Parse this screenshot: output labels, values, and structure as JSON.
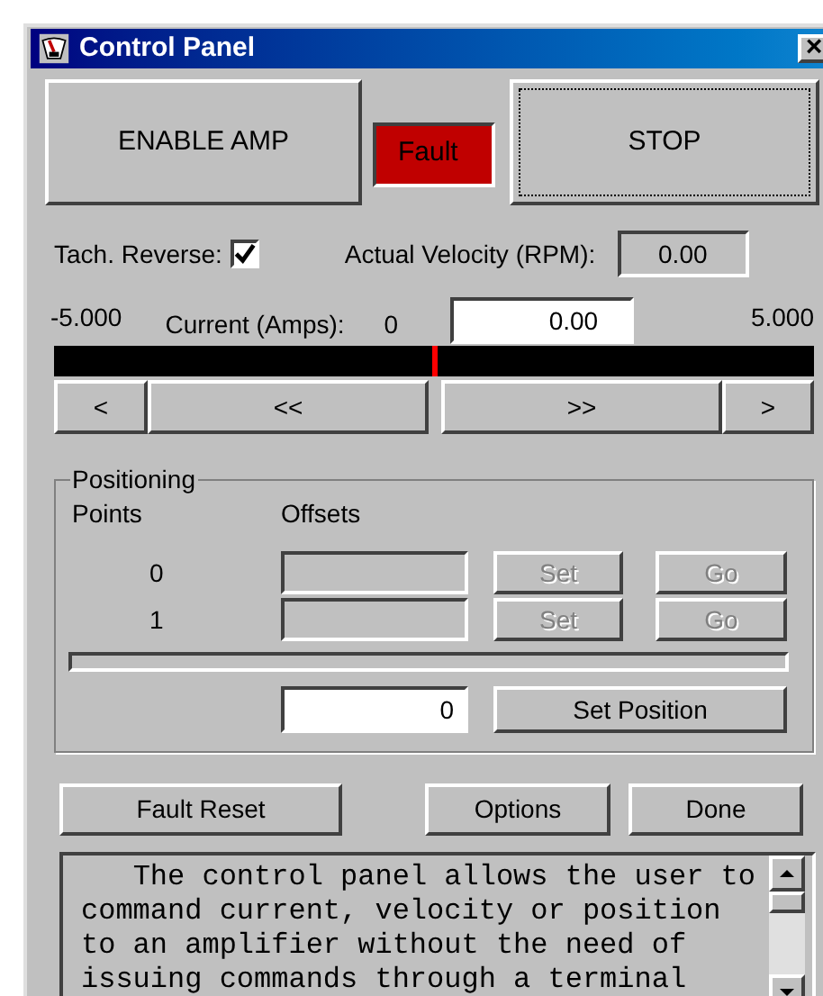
{
  "window": {
    "title": "Control Panel",
    "close": "×"
  },
  "enable_button": "ENABLE AMP",
  "fault_indicator": {
    "label": "Fault",
    "on": true
  },
  "stop_button": {
    "label": "STOP",
    "focused": true
  },
  "tach_reverse": {
    "label": "Tach. Reverse:",
    "checked": true
  },
  "actual_velocity": {
    "label": "Actual Velocity (RPM):",
    "value": "0.00"
  },
  "current": {
    "min": "-5.000",
    "label": "Current (Amps):",
    "zero": "0",
    "value": "0.00",
    "max": "5.000",
    "level": 0.5
  },
  "jog_buttons": [
    "<",
    "<<",
    ">>",
    ">"
  ],
  "positioning": {
    "title": "Positioning",
    "points_header": "Points",
    "offsets_header": "Offsets",
    "rows": [
      {
        "point": "0",
        "set": "Set",
        "go": "Go",
        "disabled": true
      },
      {
        "point": "1",
        "set": "Set",
        "go": "Go",
        "disabled": true
      }
    ],
    "progress": {
      "level": 0
    },
    "position_value": "0",
    "set_position": "Set Position"
  },
  "bottom_buttons": [
    "Fault Reset",
    "Options",
    "Done"
  ],
  "help_text": "   The control panel allows the user to\ncommand current, velocity or position\nto an amplifier without the need of\nissuing commands through a terminal"
}
